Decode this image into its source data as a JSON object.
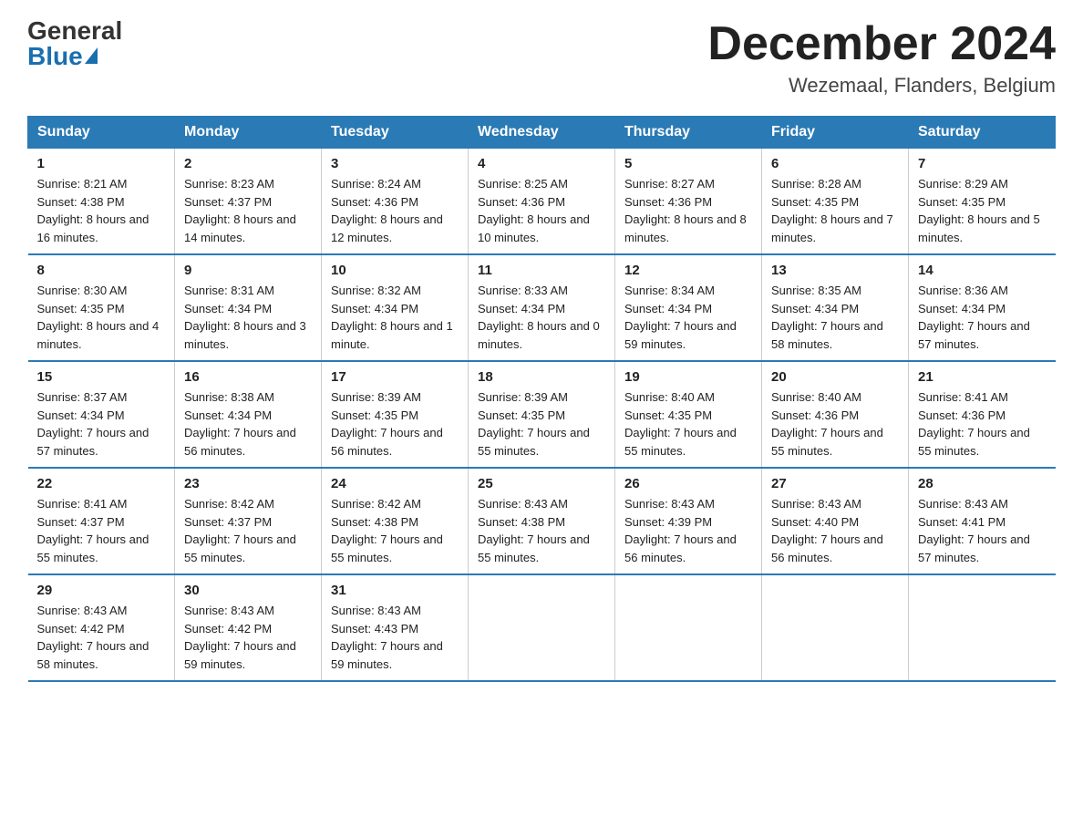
{
  "logo": {
    "general": "General",
    "blue": "Blue"
  },
  "title": "December 2024",
  "location": "Wezemaal, Flanders, Belgium",
  "days_of_week": [
    "Sunday",
    "Monday",
    "Tuesday",
    "Wednesday",
    "Thursday",
    "Friday",
    "Saturday"
  ],
  "weeks": [
    [
      {
        "num": "1",
        "sunrise": "8:21 AM",
        "sunset": "4:38 PM",
        "daylight": "8 hours and 16 minutes."
      },
      {
        "num": "2",
        "sunrise": "8:23 AM",
        "sunset": "4:37 PM",
        "daylight": "8 hours and 14 minutes."
      },
      {
        "num": "3",
        "sunrise": "8:24 AM",
        "sunset": "4:36 PM",
        "daylight": "8 hours and 12 minutes."
      },
      {
        "num": "4",
        "sunrise": "8:25 AM",
        "sunset": "4:36 PM",
        "daylight": "8 hours and 10 minutes."
      },
      {
        "num": "5",
        "sunrise": "8:27 AM",
        "sunset": "4:36 PM",
        "daylight": "8 hours and 8 minutes."
      },
      {
        "num": "6",
        "sunrise": "8:28 AM",
        "sunset": "4:35 PM",
        "daylight": "8 hours and 7 minutes."
      },
      {
        "num": "7",
        "sunrise": "8:29 AM",
        "sunset": "4:35 PM",
        "daylight": "8 hours and 5 minutes."
      }
    ],
    [
      {
        "num": "8",
        "sunrise": "8:30 AM",
        "sunset": "4:35 PM",
        "daylight": "8 hours and 4 minutes."
      },
      {
        "num": "9",
        "sunrise": "8:31 AM",
        "sunset": "4:34 PM",
        "daylight": "8 hours and 3 minutes."
      },
      {
        "num": "10",
        "sunrise": "8:32 AM",
        "sunset": "4:34 PM",
        "daylight": "8 hours and 1 minute."
      },
      {
        "num": "11",
        "sunrise": "8:33 AM",
        "sunset": "4:34 PM",
        "daylight": "8 hours and 0 minutes."
      },
      {
        "num": "12",
        "sunrise": "8:34 AM",
        "sunset": "4:34 PM",
        "daylight": "7 hours and 59 minutes."
      },
      {
        "num": "13",
        "sunrise": "8:35 AM",
        "sunset": "4:34 PM",
        "daylight": "7 hours and 58 minutes."
      },
      {
        "num": "14",
        "sunrise": "8:36 AM",
        "sunset": "4:34 PM",
        "daylight": "7 hours and 57 minutes."
      }
    ],
    [
      {
        "num": "15",
        "sunrise": "8:37 AM",
        "sunset": "4:34 PM",
        "daylight": "7 hours and 57 minutes."
      },
      {
        "num": "16",
        "sunrise": "8:38 AM",
        "sunset": "4:34 PM",
        "daylight": "7 hours and 56 minutes."
      },
      {
        "num": "17",
        "sunrise": "8:39 AM",
        "sunset": "4:35 PM",
        "daylight": "7 hours and 56 minutes."
      },
      {
        "num": "18",
        "sunrise": "8:39 AM",
        "sunset": "4:35 PM",
        "daylight": "7 hours and 55 minutes."
      },
      {
        "num": "19",
        "sunrise": "8:40 AM",
        "sunset": "4:35 PM",
        "daylight": "7 hours and 55 minutes."
      },
      {
        "num": "20",
        "sunrise": "8:40 AM",
        "sunset": "4:36 PM",
        "daylight": "7 hours and 55 minutes."
      },
      {
        "num": "21",
        "sunrise": "8:41 AM",
        "sunset": "4:36 PM",
        "daylight": "7 hours and 55 minutes."
      }
    ],
    [
      {
        "num": "22",
        "sunrise": "8:41 AM",
        "sunset": "4:37 PM",
        "daylight": "7 hours and 55 minutes."
      },
      {
        "num": "23",
        "sunrise": "8:42 AM",
        "sunset": "4:37 PM",
        "daylight": "7 hours and 55 minutes."
      },
      {
        "num": "24",
        "sunrise": "8:42 AM",
        "sunset": "4:38 PM",
        "daylight": "7 hours and 55 minutes."
      },
      {
        "num": "25",
        "sunrise": "8:43 AM",
        "sunset": "4:38 PM",
        "daylight": "7 hours and 55 minutes."
      },
      {
        "num": "26",
        "sunrise": "8:43 AM",
        "sunset": "4:39 PM",
        "daylight": "7 hours and 56 minutes."
      },
      {
        "num": "27",
        "sunrise": "8:43 AM",
        "sunset": "4:40 PM",
        "daylight": "7 hours and 56 minutes."
      },
      {
        "num": "28",
        "sunrise": "8:43 AM",
        "sunset": "4:41 PM",
        "daylight": "7 hours and 57 minutes."
      }
    ],
    [
      {
        "num": "29",
        "sunrise": "8:43 AM",
        "sunset": "4:42 PM",
        "daylight": "7 hours and 58 minutes."
      },
      {
        "num": "30",
        "sunrise": "8:43 AM",
        "sunset": "4:42 PM",
        "daylight": "7 hours and 59 minutes."
      },
      {
        "num": "31",
        "sunrise": "8:43 AM",
        "sunset": "4:43 PM",
        "daylight": "7 hours and 59 minutes."
      },
      null,
      null,
      null,
      null
    ]
  ],
  "labels": {
    "sunrise": "Sunrise:",
    "sunset": "Sunset:",
    "daylight": "Daylight:"
  }
}
